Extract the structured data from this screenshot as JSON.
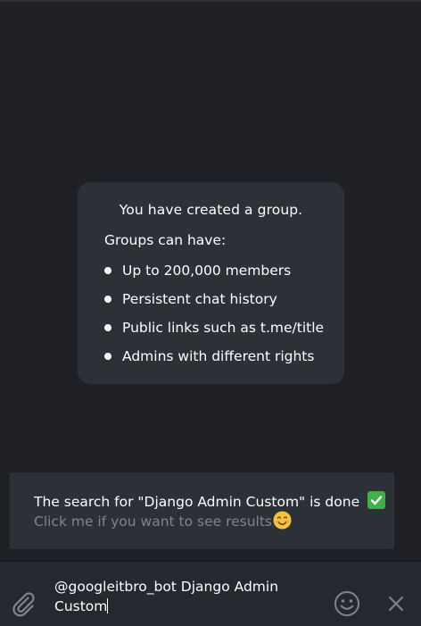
{
  "service_message": {
    "title": "You have created a group.",
    "subtitle": "Groups can have:",
    "features": [
      "Up to 200,000 members",
      "Persistent chat history",
      "Public links such as t.me/title",
      "Admins with different rights"
    ]
  },
  "inline_result": {
    "title": "The search for \"Django Admin Custom\" is done",
    "description": "Click me if you want to see results"
  },
  "composer": {
    "line1": "@googleitbro_bot Django Admin",
    "line2": "Custom"
  },
  "icons": {
    "attach": "paperclip-icon",
    "emoji": "smiley-icon",
    "cancel": "close-icon",
    "check": "check-mark-icon",
    "smile": "smiling-face-icon"
  },
  "colors": {
    "background": "#1e2025",
    "card": "#2c3037",
    "muted_text": "#7d8590",
    "check_green": "#43b047"
  }
}
